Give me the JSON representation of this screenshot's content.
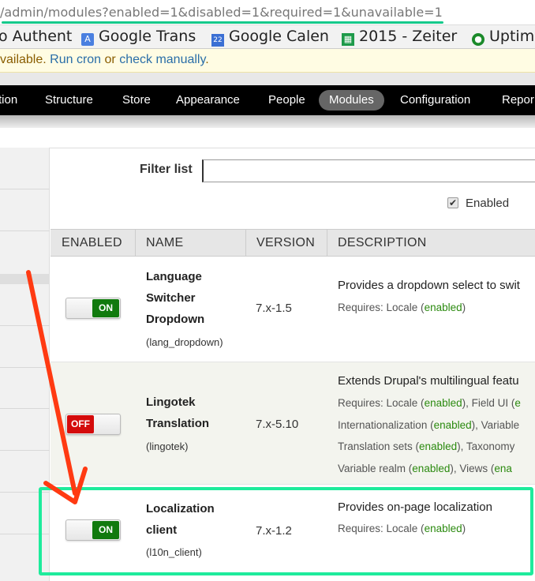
{
  "browser": {
    "url": "/admin/modules?enabled=1&disabled=1&required=1&unavailable=1",
    "bookmarks": [
      {
        "label": "o Authent",
        "icon": "auth-icon"
      },
      {
        "label": "Google Trans",
        "icon": "google-translate-icon"
      },
      {
        "label": "Google Calen",
        "icon": "google-calendar-icon",
        "icon_text": "22"
      },
      {
        "label": "2015 - Zeiter",
        "icon": "spreadsheet-icon"
      },
      {
        "label": "Uptim",
        "icon": "uptime-icon"
      }
    ]
  },
  "message": {
    "prefix": "vailable. ",
    "run_cron": "Run cron",
    "or": " or ",
    "check_manually": "check manually",
    "suffix": "."
  },
  "toolbar": {
    "items": [
      "tion",
      "Structure",
      "Store",
      "Appearance",
      "People",
      "Modules",
      "Configuration",
      "Repor"
    ],
    "active": "Modules"
  },
  "filter": {
    "label": "Filter list",
    "value": "",
    "enabled_checkbox_label": "Enabled",
    "enabled_checked": true
  },
  "table": {
    "columns": [
      "ENABLED",
      "NAME",
      "VERSION",
      "DESCRIPTION"
    ],
    "rows": [
      {
        "enabled": true,
        "toggle_label": "ON",
        "name_lines": [
          "Language",
          "Switcher",
          "Dropdown"
        ],
        "machine": "(lang_dropdown)",
        "version": "7.x-1.5",
        "description": "Provides a dropdown select to swit",
        "requires_lines": [
          [
            {
              "t": "Requires: Locale ("
            },
            {
              "t": "enabled",
              "ok": true
            },
            {
              "t": ")"
            }
          ]
        ]
      },
      {
        "enabled": false,
        "toggle_label": "OFF",
        "name_lines": [
          "Lingotek",
          "Translation"
        ],
        "machine": "(lingotek)",
        "version": "7.x-5.10",
        "description": "Extends Drupal's multilingual featu",
        "requires_lines": [
          [
            {
              "t": "Requires: Locale ("
            },
            {
              "t": "enabled",
              "ok": true
            },
            {
              "t": "), Field UI ("
            },
            {
              "t": "e",
              "ok": true
            }
          ],
          [
            {
              "t": "Internationalization ("
            },
            {
              "t": "enabled",
              "ok": true
            },
            {
              "t": "), Variable"
            }
          ],
          [
            {
              "t": "Translation sets ("
            },
            {
              "t": "enabled",
              "ok": true
            },
            {
              "t": "), Taxonomy"
            }
          ],
          [
            {
              "t": "Variable realm ("
            },
            {
              "t": "enabled",
              "ok": true
            },
            {
              "t": "), Views ("
            },
            {
              "t": "ena",
              "ok": true
            }
          ]
        ]
      },
      {
        "enabled": true,
        "toggle_label": "ON",
        "name_lines": [
          "Localization",
          "client"
        ],
        "machine": "(l10n_client)",
        "version": "7.x-1.2",
        "description": "Provides on-page localization",
        "requires_lines": [
          [
            {
              "t": "Requires: Locale ("
            },
            {
              "t": "enabled",
              "ok": true
            },
            {
              "t": ")"
            }
          ]
        ]
      }
    ]
  },
  "colors": {
    "highlight": "#1eeb9c",
    "arrow": "#ff3a12",
    "toggle_on": "#117a0e",
    "toggle_off": "#d40b0b",
    "enabled_text": "#2b8a0f"
  }
}
